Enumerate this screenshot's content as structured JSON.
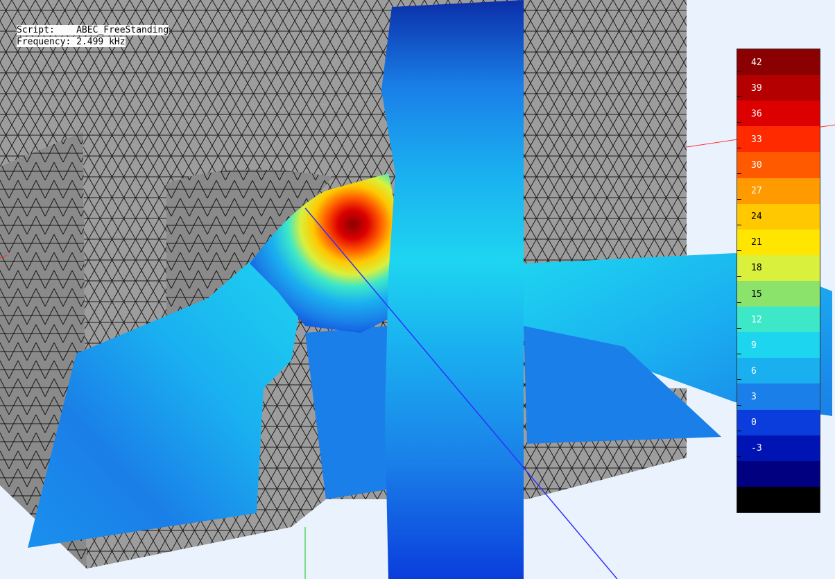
{
  "info": {
    "script_label": "Script:",
    "script_value": "ABEC_FreeStanding",
    "frequency_label": "Frequency:",
    "frequency_value": "2.499 kHz"
  },
  "legend": {
    "levels": [
      42,
      39,
      36,
      33,
      30,
      27,
      24,
      21,
      18,
      15,
      12,
      9,
      6,
      3,
      0,
      -3
    ],
    "colors": [
      "#8b0000",
      "#b40000",
      "#dc0000",
      "#ff2a00",
      "#ff5a00",
      "#ff9a00",
      "#ffc800",
      "#ffe600",
      "#d9f03c",
      "#8ce36c",
      "#3de8c8",
      "#1ed5f0",
      "#1ab0f0",
      "#1a7fe8",
      "#0a3ddc",
      "#0014b4",
      "#000080",
      "#000000"
    ]
  },
  "colors": {
    "background": "#eaf3fd",
    "mesh_fill": "#9d9d9d",
    "mesh_lines": "#1a1a1a",
    "axis_x": "#ff3030",
    "axis_y": "#10c010",
    "axis_z": "#3030ff"
  },
  "icons": [
    "mesh-enclosure",
    "pressure-field-slice"
  ]
}
